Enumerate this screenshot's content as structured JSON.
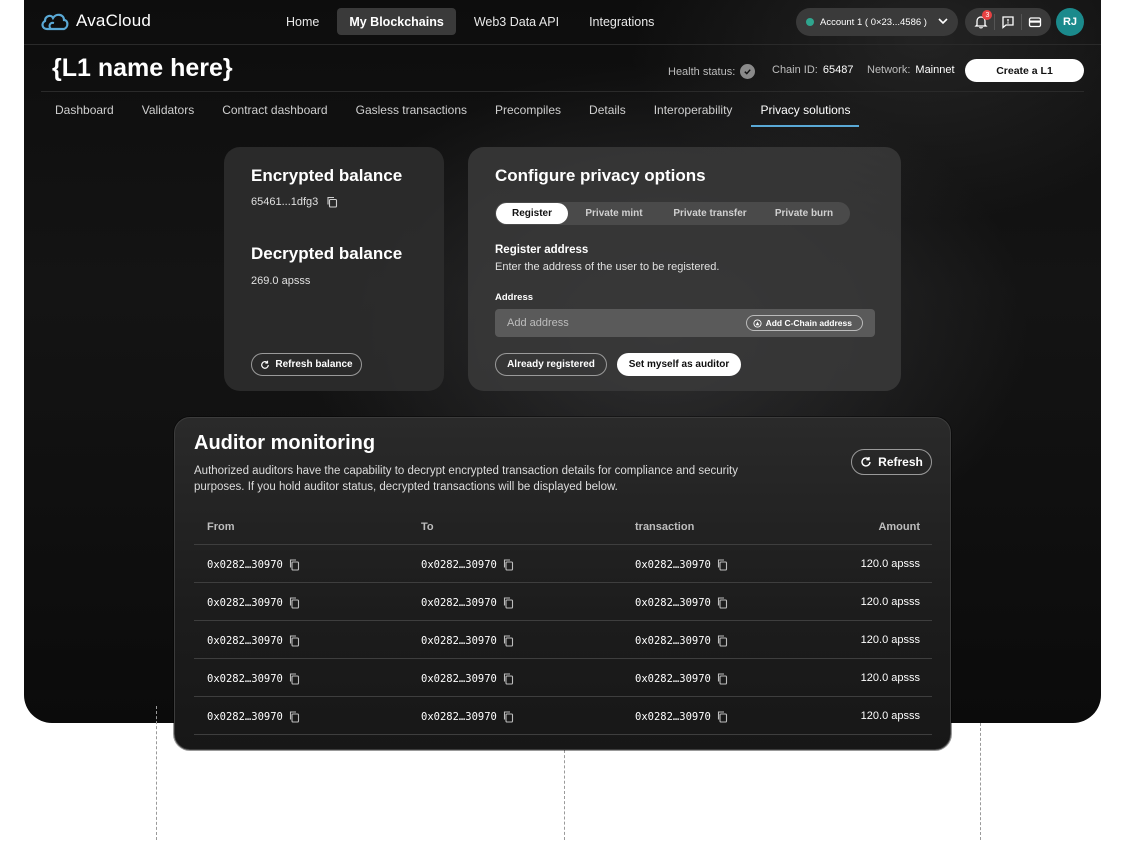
{
  "brand": {
    "name": "AvaCloud",
    "accent": "#5aa9d6"
  },
  "topnav": {
    "items": [
      {
        "label": "Home",
        "active": false
      },
      {
        "label": "My Blockchains",
        "active": true
      },
      {
        "label": "Web3 Data API",
        "active": false
      },
      {
        "label": "Integrations",
        "active": false
      }
    ]
  },
  "account": {
    "label": "Account 1 ( 0×23...4586 )",
    "status_color": "#2fa58e"
  },
  "notifications": {
    "count": "3"
  },
  "user": {
    "initials": "RJ",
    "avatar_color": "#1b8a8c"
  },
  "header": {
    "title": "{L1 name here}",
    "health_label": "Health status:",
    "chain_id_label": "Chain ID:",
    "chain_id": "65487",
    "network_label": "Network:",
    "network": "Mainnet",
    "create_button": "Create a L1"
  },
  "tabs": [
    {
      "label": "Dashboard",
      "active": false
    },
    {
      "label": "Validators",
      "active": false
    },
    {
      "label": "Contract dashboard",
      "active": false
    },
    {
      "label": "Gasless transactions",
      "active": false
    },
    {
      "label": "Precompiles",
      "active": false
    },
    {
      "label": "Details",
      "active": false
    },
    {
      "label": "Interoperability",
      "active": false
    },
    {
      "label": "Privacy solutions",
      "active": true
    }
  ],
  "balance": {
    "encrypted_title": "Encrypted balance",
    "encrypted_value": "65461...1dfg3",
    "decrypted_title": "Decrypted balance",
    "decrypted_value": "269.0 apsss",
    "refresh_button": "Refresh balance"
  },
  "config": {
    "title": "Configure privacy options",
    "segments": [
      "Register",
      "Private mint",
      "Private transfer",
      "Private burn"
    ],
    "active_segment": "Register",
    "section_title": "Register address",
    "section_desc": "Enter the address of the user to be registered.",
    "address_label": "Address",
    "address_placeholder": "Add address",
    "add_cchain_button": "Add C-Chain address",
    "already_registered_button": "Already registered",
    "set_auditor_button": "Set myself as auditor"
  },
  "auditor": {
    "title": "Auditor monitoring",
    "description": "Authorized auditors have the capability to decrypt encrypted transaction details for compliance and security purposes. If you hold auditor status, decrypted transactions will be displayed below.",
    "refresh_button": "Refresh",
    "columns": [
      "From",
      "To",
      "transaction",
      "Amount"
    ],
    "rows": [
      {
        "from": "0x0282…30970",
        "to": "0x0282…30970",
        "tx": "0x0282…30970",
        "amount": "120.0 apsss"
      },
      {
        "from": "0x0282…30970",
        "to": "0x0282…30970",
        "tx": "0x0282…30970",
        "amount": "120.0 apsss"
      },
      {
        "from": "0x0282…30970",
        "to": "0x0282…30970",
        "tx": "0x0282…30970",
        "amount": "120.0 apsss"
      },
      {
        "from": "0x0282…30970",
        "to": "0x0282…30970",
        "tx": "0x0282…30970",
        "amount": "120.0 apsss"
      },
      {
        "from": "0x0282…30970",
        "to": "0x0282…30970",
        "tx": "0x0282…30970",
        "amount": "120.0 apsss"
      }
    ]
  }
}
